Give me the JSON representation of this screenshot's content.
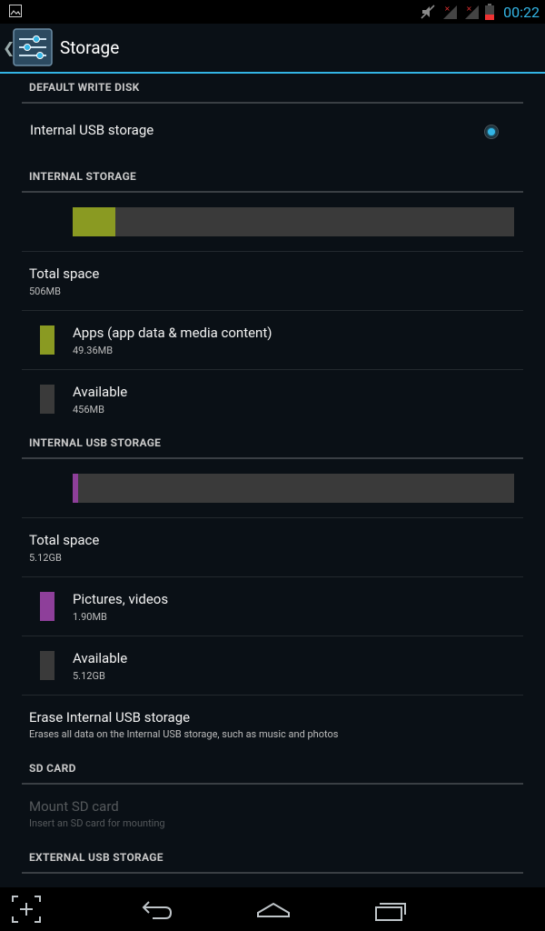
{
  "status_bar": {
    "time": "00:22",
    "icons": [
      "image-notification-icon",
      "mute-icon",
      "no-signal-icon",
      "no-signal-icon",
      "battery-low-icon"
    ]
  },
  "action_bar": {
    "title": "Storage",
    "icon": "settings-sliders-icon"
  },
  "sections": {
    "default_write_disk": {
      "header": "DEFAULT WRITE DISK",
      "item_title": "Internal USB storage",
      "selected": true
    },
    "internal_storage": {
      "header": "INTERNAL STORAGE",
      "usage_fraction": 0.0975,
      "usage_color": "#8a9a22",
      "total_title": "Total space",
      "total_value": "506MB",
      "apps_title": "Apps (app data & media content)",
      "apps_value": "49.36MB",
      "apps_color": "#8a9a22",
      "available_title": "Available",
      "available_value": "456MB",
      "available_color": "#3a3a3a"
    },
    "internal_usb_storage": {
      "header": "INTERNAL USB STORAGE",
      "usage_fraction": 0.012,
      "usage_color": "#8e3f9a",
      "total_title": "Total space",
      "total_value": "5.12GB",
      "pictures_title": "Pictures, videos",
      "pictures_value": "1.90MB",
      "pictures_color": "#8e3f9a",
      "available_title": "Available",
      "available_value": "5.12GB",
      "available_color": "#3a3a3a",
      "erase_title": "Erase Internal USB storage",
      "erase_summary": "Erases all data on the Internal USB storage, such as music and photos"
    },
    "sd_card": {
      "header": "SD CARD",
      "mount_title": "Mount SD card",
      "mount_summary": "Insert an SD card for mounting"
    },
    "external_usb_storage": {
      "header": "EXTERNAL USB STORAGE"
    }
  },
  "nav_bar": {
    "buttons": [
      "screenshot-icon",
      "back-icon",
      "home-icon",
      "recent-apps-icon"
    ]
  },
  "colors": {
    "accent": "#33b5e5",
    "background": "#0a1016"
  }
}
